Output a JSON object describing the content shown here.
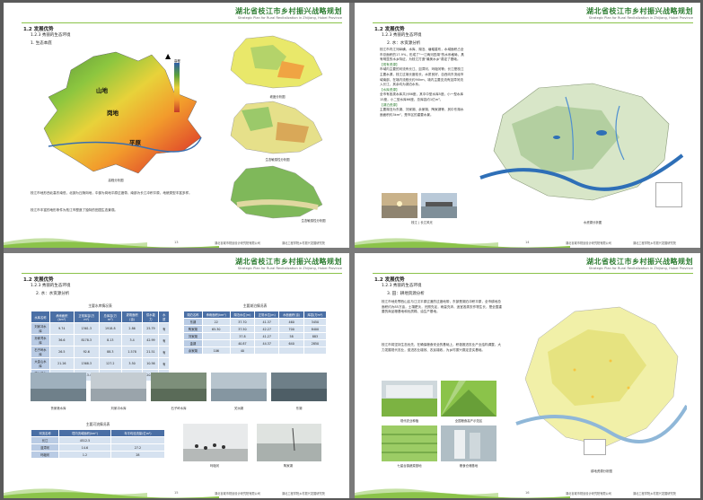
{
  "header": {
    "title": "湖北省枝江市乡村振兴战略规划",
    "subtitle": "Strategic Plan for Rural Revitalization in Zhijiang, Hubei Province"
  },
  "footer": {
    "left": "湖北省城市规划设计研究院有限公司",
    "right": "湖北工程学院乡村振兴发展研究院"
  },
  "page1": {
    "h1": "1.2  发展优势",
    "h2": "1.2.3  秀丽的生态环境",
    "h3": "1. 生态本底",
    "labels": {
      "shan": "山地",
      "gang": "岗地",
      "ping": "平原"
    },
    "legend_title": "高程",
    "cap_main": "高程分析图",
    "cap_slope": "坡度分析图",
    "cap_eco": "生态敏感性分析图",
    "para1": "枝江市地形西北高东南低，北部为丘陵岗地，中部为岗地平原过渡带，南部为长江冲积平原，地貌类型丰富多样。",
    "para2": "枝江市丰富的地形条件为枝江市塑造了独特的田园生态景观。",
    "page_no": "13"
  },
  "page2": {
    "h1": "1.2  发展优势",
    "h2": "1.2.3  秀丽的生态环境",
    "h3": "2. 水：水资源分析",
    "para1": "枝江市内江河纵横，水库、湖泊、塘堰星布，水域面积占全市总面积的17.9%，形成了\"一江两河四湖\"的水系格局，具有明显的水乡特征，为枝江打造\"最美水乡\"奠定了基础。",
    "sub1": "【现有资源】",
    "para2": "市域内主要的河流有长江、沮漳河、玛瑙河等；长江是枝江主要水源，枝江过境长度较长，水质良好，自西向东流经市域南部，在境内流程长约90km，境内主要支流有沮漳河流入长江，其余均为湖泊水系。",
    "sub2": "【水库资源】",
    "para3": "全市有各类水库共计86座，其中中型水库5座，小一型水库15座，小二型水库66座，总库容约1亿m³。",
    "sub3": "【湖泊资源】",
    "para4": "主要湖泊为东湖、刘家湖、余家湖、陶家湖等，其中东湖水面面积约3km²，是市区的重要水景。",
    "sub4": "【地下水资源】",
    "para5": "地下水资源分布广泛，一类含水层、浅层地下水丰富，可供开采利用，属于优质地下水资源，为城乡供水提供了可靠保障。",
    "cap_photo": "枝江 | 长江风光",
    "cap_map": "水资源分析图",
    "page_no": "14"
  },
  "page3": {
    "h1": "1.2  发展优势",
    "h2": "1.2.3  秀丽的生态环境",
    "h3": "2. 水：水资源分析",
    "t1_title": "主要水库情况表",
    "t1_head": [
      "水库名称",
      "承雨面积(km²)",
      "正常库容(万m³)",
      "总库容(万m³)",
      "灌溉面积(亩)",
      "供水能力",
      "水质"
    ],
    "t1_rows": [
      [
        "刘家冲水库",
        "9.74",
        "1361.3",
        "1918.8",
        "2.86",
        "25.79",
        "有"
      ],
      [
        "孙家湾水库",
        "36.6",
        "8178.3",
        "8.13",
        "3.4",
        "42.99",
        "有"
      ],
      [
        "石子岭水库",
        "26.5",
        "92.6",
        "88.3",
        "1.578",
        "21.51",
        "有"
      ],
      [
        "大金山水库",
        "21.26",
        "1368.3",
        "127.2",
        "3.50",
        "10.56",
        "有"
      ],
      [
        "鸡公冲水库",
        "21.23",
        "1113.4",
        "1110",
        "1.60",
        "20.40",
        "有"
      ]
    ],
    "t2_title": "主要湖泊情况表",
    "t2_head": [
      "湖泊名称",
      "承雨面积(km²)",
      "湖泊水位(m)",
      "正常水位(m)",
      "水面面积(亩)",
      "库容(万m³)"
    ],
    "t2_rows": [
      [
        "东湖",
        "22",
        "37.70",
        "41.37",
        "460",
        "3450"
      ],
      [
        "陶家湖",
        "65.30",
        "37.50",
        "42.27",
        "700",
        "8400"
      ],
      [
        "刘家湖",
        "",
        "37.8",
        "41.27",
        "58",
        "883"
      ],
      [
        "金湖",
        "",
        "40.87",
        "44.37",
        "640",
        "2850"
      ],
      [
        "余家湖",
        "106",
        "40",
        "",
        "",
        ""
      ]
    ],
    "t3_title": "主要河流情况表",
    "t3_head": [
      "河流名称",
      "境内流域面积(km²)",
      "年平均径流量(亿m³)"
    ],
    "t3_rows": [
      [
        "长江",
        "4512.5",
        ""
      ],
      [
        "沮漳河",
        "14.6",
        "27.2"
      ],
      [
        "玛瑙河",
        "1.2",
        "28"
      ]
    ],
    "photo_caps": [
      "鲁家港水库",
      "刘家冲水库",
      "石子岭水库",
      "关洲湖",
      "东湖"
    ],
    "photo_caps2": [
      "玛瑙河",
      "陶家湖"
    ],
    "page_no": "15"
  },
  "page4": {
    "h1": "1.2  发展优势",
    "h2": "1.2.3  秀丽的生态环境",
    "h3": "3. 田：耕地资源分析",
    "para1": "枝江市地处鄂西山区与江汉平原过渡的过渡地带，东部是湖泊冲积平原，全市耕地总面积约为85万亩，土壤肥沃，光照充足，雨量充沛，适宜各类农作物生长，是全国重要的商品粮基地和优质棉、油生产基地。",
    "para2": "枝江市将坚持生态优先，在确保粮食安全的基础上，积极推进农业产业结构调整，大力发展现代农业，促进农业增效、农民增收，为乡村振兴奠定坚实基础。",
    "photo_caps": [
      "现代农业种植",
      "全国粮食高产示范区",
      "七星台镇蔬菜基地",
      "粮食仓储基地"
    ],
    "cap_map": "耕地资源分析图",
    "page_no": "16"
  },
  "colors": {
    "accent": "#2e7d32",
    "table_head": "#4a6fa5",
    "table_cell": "#d6e2f0",
    "water": "#3a6fb0"
  }
}
